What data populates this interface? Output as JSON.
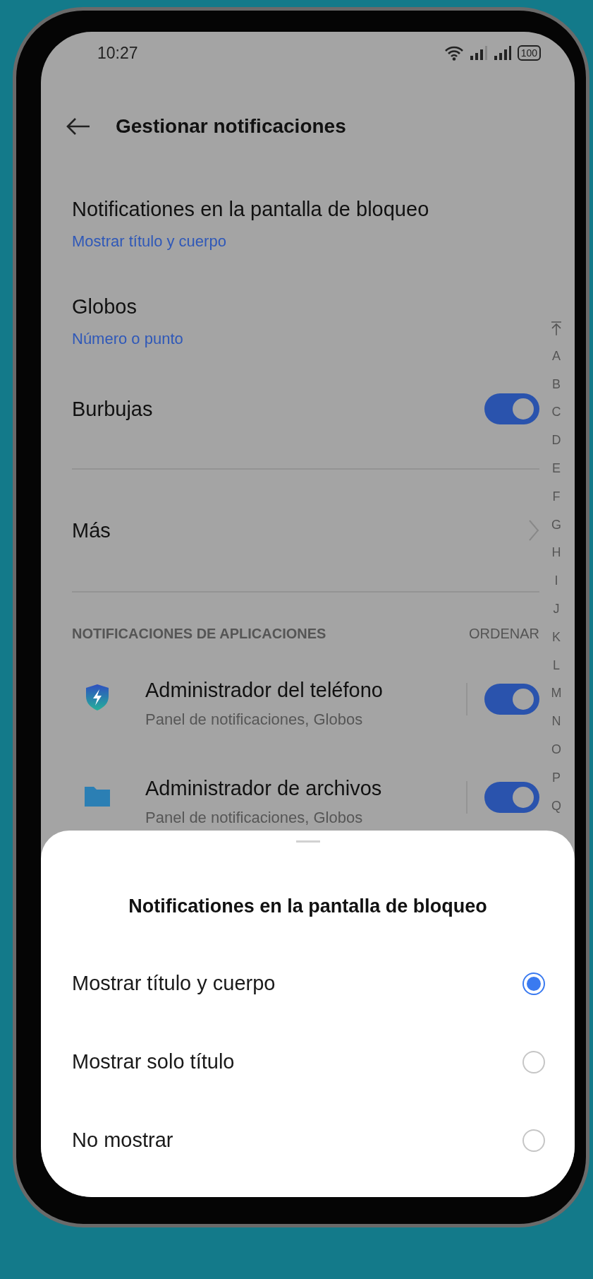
{
  "status_bar": {
    "time": "10:27",
    "battery": "100"
  },
  "header": {
    "title": "Gestionar notificaciones"
  },
  "settings": [
    {
      "kind": "value",
      "title": "Notificationes en la pantalla de bloqueo",
      "value": "Mostrar título y cuerpo"
    },
    {
      "kind": "value",
      "title": "Globos",
      "value": "Número o punto"
    },
    {
      "kind": "toggle",
      "title": "Burbujas",
      "on": true
    },
    {
      "kind": "link",
      "title": "Más"
    }
  ],
  "app_notifications": {
    "header": "NOTIFICACIONES DE APLICACIONES",
    "sort": "ORDENAR",
    "apps": [
      {
        "kind": "shield",
        "name": "Administrador del teléfono",
        "summary": "Panel de notificaciones, Globos",
        "on": true
      },
      {
        "kind": "folder",
        "name": "Administrador de archivos",
        "summary": "Panel de notificaciones, Globos",
        "on": true
      }
    ]
  },
  "index_bar": [
    "A",
    "B",
    "C",
    "D",
    "E",
    "F",
    "G",
    "H",
    "I",
    "J",
    "K",
    "L",
    "M",
    "N",
    "O",
    "P",
    "Q"
  ],
  "sheet": {
    "title": "Notificationes en la pantalla de bloqueo",
    "options": [
      {
        "label": "Mostrar título y cuerpo",
        "selected": true
      },
      {
        "label": "Mostrar solo título",
        "selected": false
      },
      {
        "label": "No mostrar",
        "selected": false
      }
    ]
  }
}
